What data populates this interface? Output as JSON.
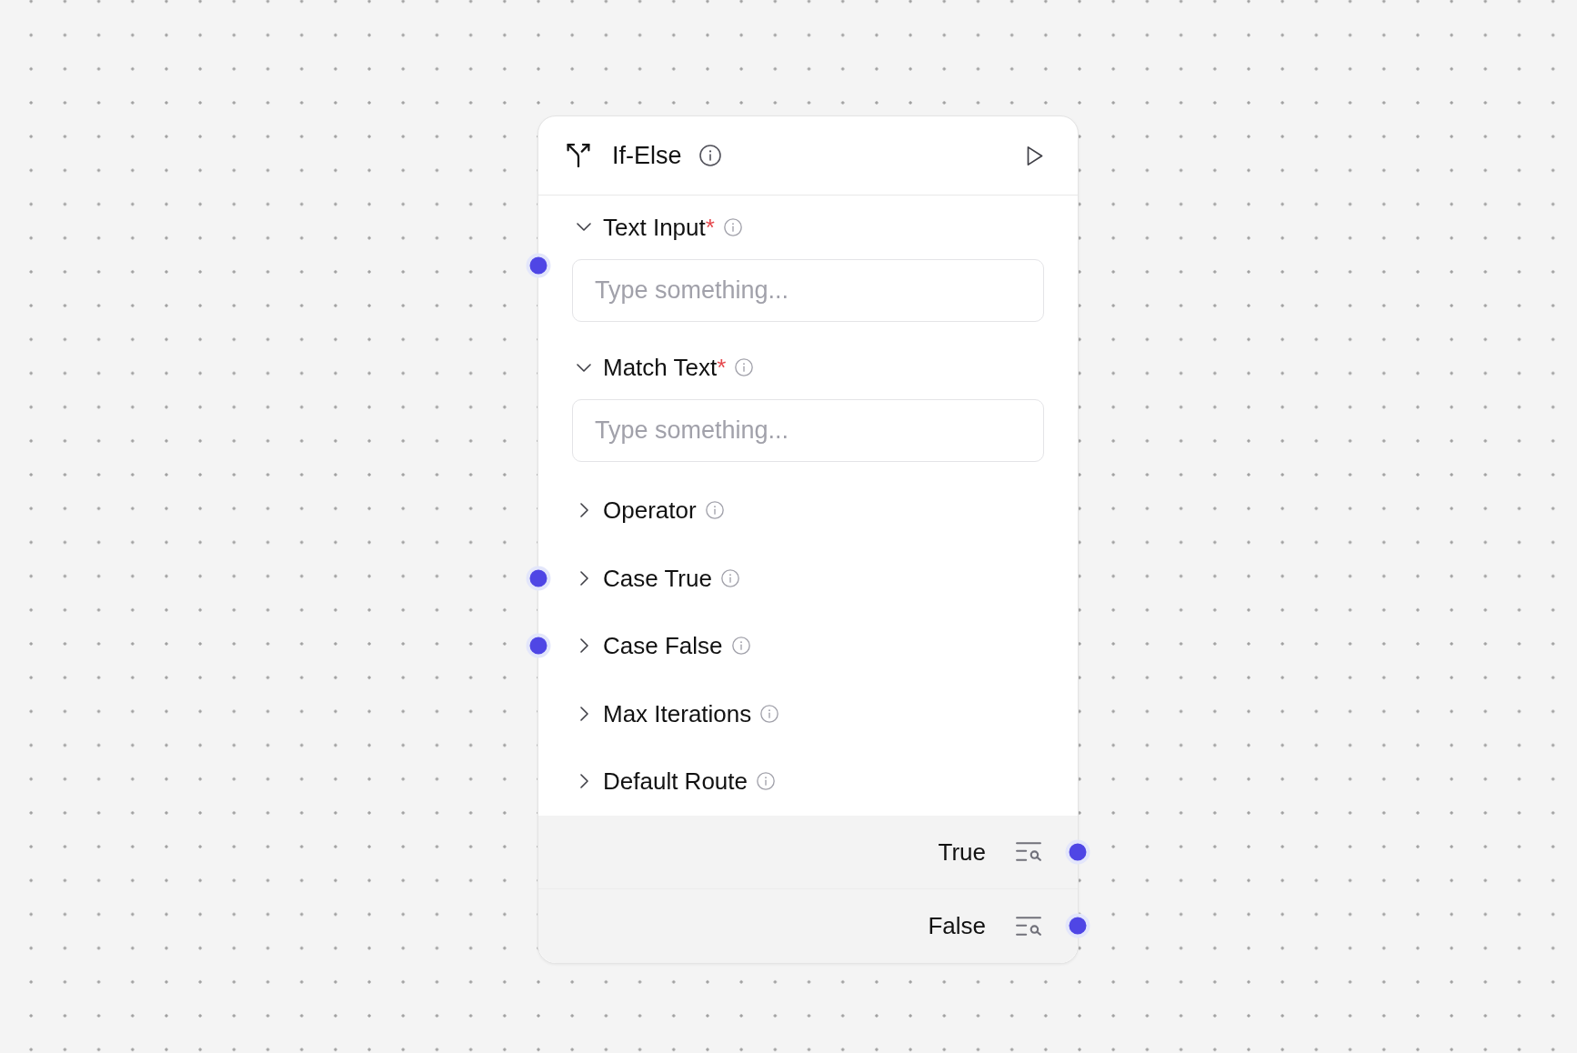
{
  "node": {
    "title": "If-Else",
    "fields": [
      {
        "label": "Text Input",
        "required_mark": "*",
        "expanded": true,
        "handle": true,
        "placeholder": "Type something..."
      },
      {
        "label": "Match Text",
        "required_mark": "*",
        "expanded": true,
        "handle": false,
        "placeholder": "Type something..."
      },
      {
        "label": "Operator",
        "expanded": false,
        "handle": false
      },
      {
        "label": "Case True",
        "expanded": false,
        "handle": true
      },
      {
        "label": "Case False",
        "expanded": false,
        "handle": true
      },
      {
        "label": "Max Iterations",
        "expanded": false,
        "handle": false
      },
      {
        "label": "Default Route",
        "expanded": false,
        "handle": false
      }
    ],
    "outputs": [
      {
        "label": "True"
      },
      {
        "label": "False"
      }
    ]
  }
}
